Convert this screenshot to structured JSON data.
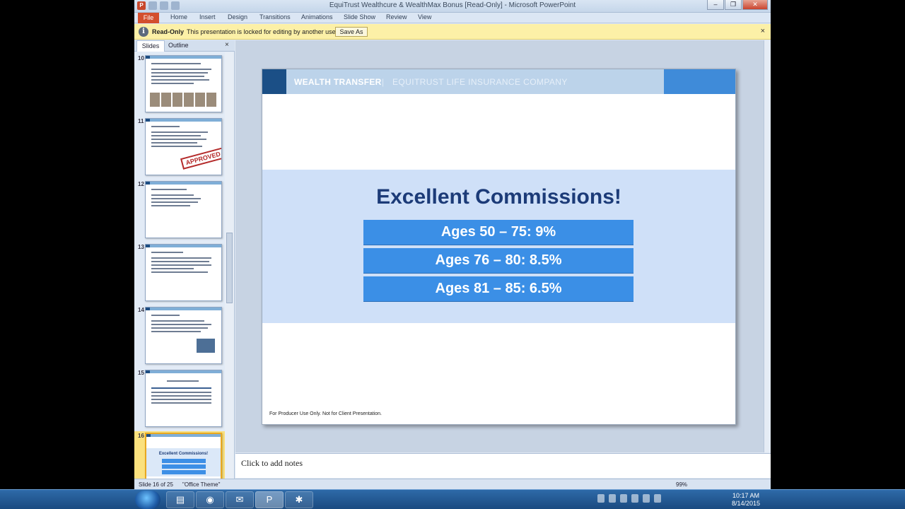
{
  "window": {
    "title": "EquiTrust Wealthcure & WealthMax Bonus [Read-Only]  -  Microsoft PowerPoint",
    "minimize": "–",
    "maximize": "❐",
    "close": "✕"
  },
  "ribbon": {
    "tabs": [
      "File",
      "Home",
      "Insert",
      "Design",
      "Transitions",
      "Animations",
      "Slide Show",
      "Review",
      "View"
    ]
  },
  "message_bar": {
    "label": "Read-Only",
    "text": "This presentation is locked for editing by another user.",
    "button": "Save As",
    "close": "×"
  },
  "panel": {
    "tabs": [
      "Slides",
      "Outline"
    ],
    "close": "×",
    "slide_numbers": [
      "10",
      "11",
      "12",
      "13",
      "14",
      "15",
      "16"
    ],
    "thumb16": {
      "title": "Excellent Commissions!",
      "rows": [
        "Ages 50 – 75: 9%",
        "Ages 76 – 80: 8.5%",
        "Ages 81 – 85: 6.5%"
      ]
    },
    "approved_stamp": "APPROVED"
  },
  "slide": {
    "brand": "WEALTH TRANSFER",
    "separator": "|",
    "company": "EQUITRUST LIFE INSURANCE COMPANY",
    "title": "Excellent Commissions!",
    "rows": [
      "Ages 50 – 75: 9%",
      "Ages 76 – 80: 8.5%",
      "Ages 81 – 85: 6.5%"
    ],
    "footer": "For Producer Use Only. Not for Client Presentation."
  },
  "notes": {
    "placeholder": "Click to add notes"
  },
  "status": {
    "slide_info": "Slide 16 of 25",
    "theme": "\"Office Theme\"",
    "zoom": "99%"
  },
  "taskbar": {
    "time": "10:17 AM",
    "date": "8/14/2015"
  },
  "colors": {
    "slide_header_dark": "#1b4f86",
    "slide_header_accent": "#3f8bd9",
    "title_text": "#1c3b78",
    "row_fill": "#3b8fe6",
    "band": "#cfe0f8",
    "file_tab": "#d34f2e"
  }
}
